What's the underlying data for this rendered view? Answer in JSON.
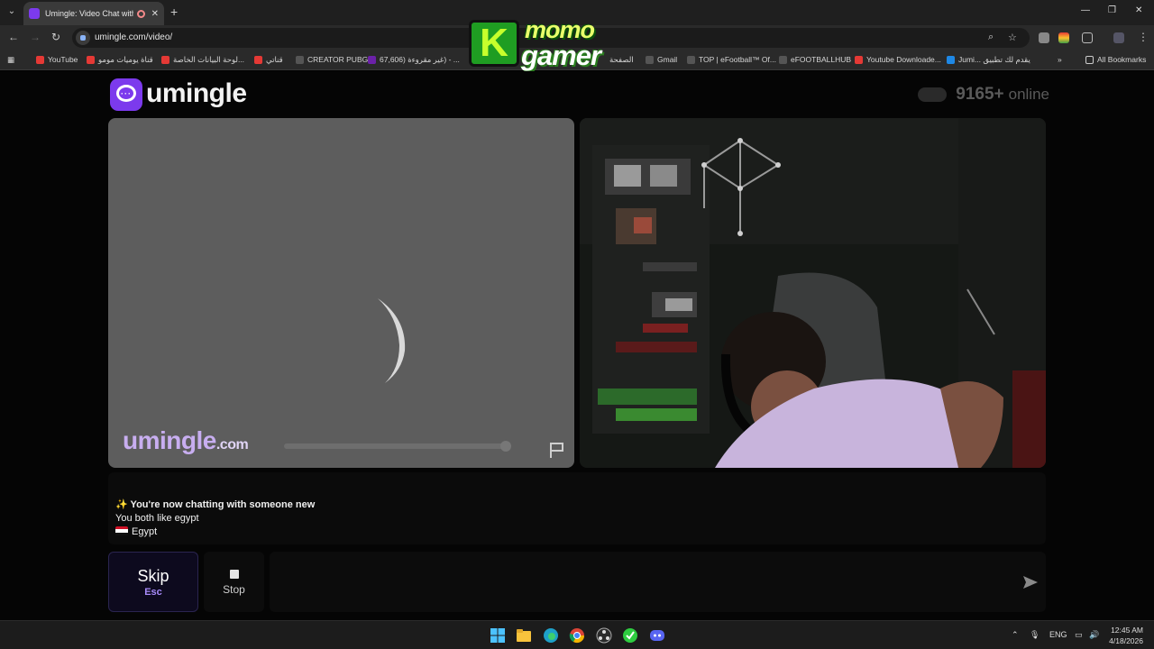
{
  "browser": {
    "tab_title": "Umingle: Video Chat with S",
    "new_tab_symbol": "+",
    "url": "umingle.com/video/",
    "bookmarks": [
      {
        "label": "YouTube",
        "color": "#e53935"
      },
      {
        "label": "قناة يوميات مومو",
        "color": "#e53935"
      },
      {
        "label": "لوحة البيانات الخاصة...",
        "color": "#e53935"
      },
      {
        "label": "قناتي",
        "color": "#e53935"
      },
      {
        "label": "CREATOR PUBG",
        "color": "#555555"
      },
      {
        "label": "67,606) غير مقروءة) - ...",
        "color": "#6b21a8"
      },
      {
        "label": "الصفحة",
        "color": "#e53935"
      },
      {
        "label": "Gmail",
        "color": "#555555"
      },
      {
        "label": "TOP | eFootball™ Of...",
        "color": "#555555"
      },
      {
        "label": "eFOOTBALLHUB",
        "color": "#555555"
      },
      {
        "label": "Youtube Downloade...",
        "color": "#e53935"
      },
      {
        "label": "Jumi... يقدم لك تطبيق",
        "color": "#1e88e5"
      }
    ],
    "more_bookmarks_symbol": "»",
    "all_bookmarks": "All Bookmarks"
  },
  "overlay": {
    "letter": "K",
    "line1": "momo",
    "line2": "gamer"
  },
  "site": {
    "brand": "umingle",
    "online_count": "9165+",
    "online_label": "online",
    "watermark_name": "umingle",
    "watermark_tld": ".com"
  },
  "chat": {
    "status": "✨ You're now chatting with someone new",
    "interest": "You both like egypt",
    "country": "Egypt"
  },
  "controls": {
    "skip_label": "Skip",
    "skip_key": "Esc",
    "stop_label": "Stop",
    "message_placeholder": ""
  },
  "taskbar": {
    "language": "ENG",
    "time": "12:45 AM",
    "date": "4/18/2026"
  },
  "colors": {
    "brand_purple": "#7c3aed",
    "watermark": "#c8aef0",
    "skip_key": "#a78bfa"
  }
}
